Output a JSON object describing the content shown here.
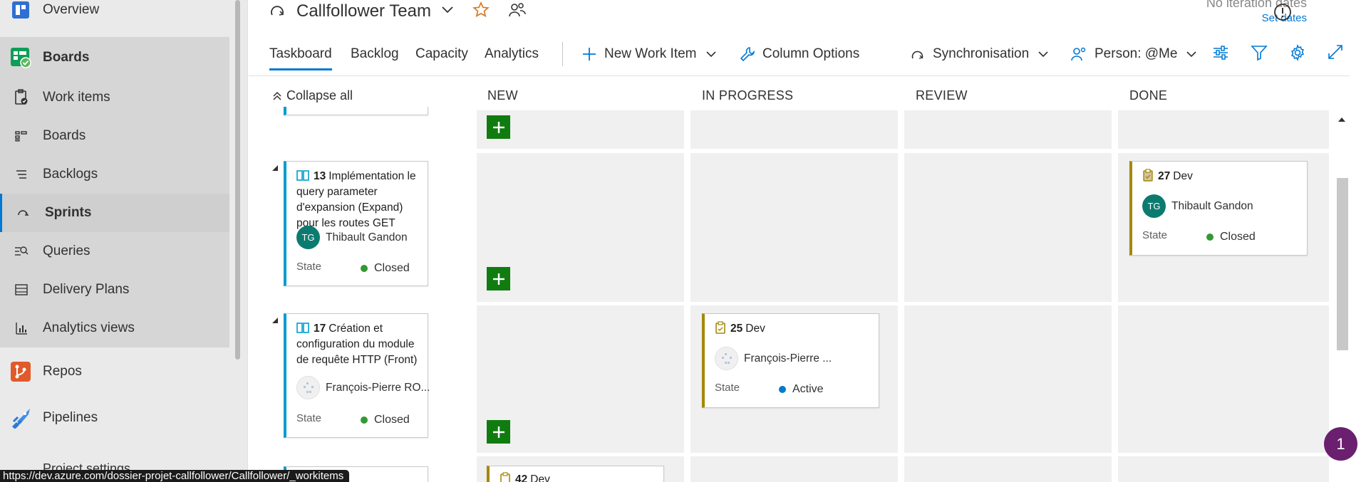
{
  "nav": {
    "items": [
      {
        "label": "Overview",
        "icon": "overview-icon"
      },
      {
        "label": "Boards",
        "icon": "boards-hub-icon"
      },
      {
        "label": "Work items",
        "icon": "work-items-icon"
      },
      {
        "label": "Boards",
        "icon": "boards-icon"
      },
      {
        "label": "Backlogs",
        "icon": "backlogs-icon"
      },
      {
        "label": "Sprints",
        "icon": "sprints-icon"
      },
      {
        "label": "Queries",
        "icon": "queries-icon"
      },
      {
        "label": "Delivery Plans",
        "icon": "delivery-plans-icon"
      },
      {
        "label": "Analytics views",
        "icon": "analytics-views-icon"
      },
      {
        "label": "Repos",
        "icon": "repos-icon"
      },
      {
        "label": "Pipelines",
        "icon": "pipelines-icon"
      }
    ],
    "project_settings": "Project settings",
    "status_url": "https://dev.azure.com/dossier-projet-callfollower/Callfollower/_workitems"
  },
  "header": {
    "team_name": "Callfollower Team",
    "no_iteration": "No iteration dates",
    "set_dates": "Set dates"
  },
  "toolbar": {
    "tabs": [
      "Taskboard",
      "Backlog",
      "Capacity",
      "Analytics"
    ],
    "new_work_item": "New Work Item",
    "column_options": "Column Options",
    "sync": "Synchronisation",
    "person": "Person: @Me"
  },
  "board": {
    "collapse_all": "Collapse all",
    "columns": [
      "NEW",
      "IN PROGRESS",
      "REVIEW",
      "DONE"
    ],
    "state_label": "State",
    "rows": [
      {
        "id": "13",
        "title": "Implémentation le query parameter d'expansion (Expand)  pour les routes GET",
        "assignee": "Thibault Gandon",
        "initials": "TG",
        "state": "Closed"
      },
      {
        "id": "17",
        "title": "Création et configuration du module de requête HTTP (Front)",
        "assignee": "François-Pierre RO...",
        "state": "Closed"
      }
    ],
    "tasks": [
      {
        "id": "27",
        "title": "Dev",
        "assignee": "Thibault Gandon",
        "initials": "TG",
        "state": "Closed"
      },
      {
        "id": "25",
        "title": "Dev",
        "assignee": "François-Pierre ...",
        "state": "Active"
      },
      {
        "id": "42",
        "title": "Dev"
      }
    ]
  },
  "help": {
    "count": "1"
  },
  "colors": {
    "accent": "#0078d4",
    "add": "#107c10",
    "closed": "#339933",
    "active": "#007acc",
    "story": "#009ccc",
    "task": "#a4880a"
  }
}
